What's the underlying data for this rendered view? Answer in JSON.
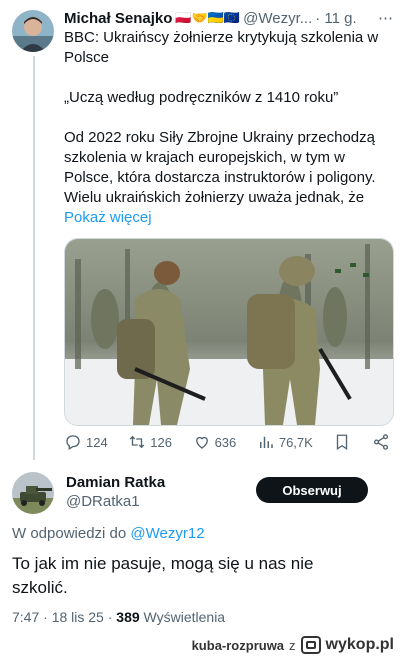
{
  "tweet1": {
    "author": "Michał Senajko",
    "flags": "🇵🇱🤝🇺🇦🇪🇺",
    "handle": "@Wezyr...",
    "time": "· 11 g.",
    "lines": [
      "BBC: Ukraińscy żołnierze krytykują szkolenia w",
      "Polsce",
      "",
      "„Uczą według podręczników z 1410 roku”",
      "",
      "Od 2022 roku Siły Zbrojne Ukrainy przechodzą",
      "szkolenia w krajach europejskich, w tym w",
      "Polsce, która dostarcza instruktorów i poligony.",
      "Wielu ukraińskich żołnierzy uważa jednak, że"
    ],
    "show_more": "Pokaż więcej",
    "stats": {
      "replies": "124",
      "reposts": "126",
      "likes": "636",
      "views": "76,7K"
    }
  },
  "tweet2": {
    "author": "Damian Ratka",
    "handle": "@DRatka1",
    "follow_label": "Obserwuj",
    "reply_to_prefix": "W odpowiedzi do",
    "reply_to_handle": "@Wezyr12",
    "text_line1": "To jak im nie pasuje, mogą się u nas nie",
    "text_line2": "szkolić.",
    "time": "7:47 · 18 lis 25 ·",
    "views_count": "389",
    "views_label": "Wyświetlenia"
  },
  "watermark": {
    "user": "kuba-rozpruwa",
    "sep": "z",
    "brand": "wykop.pl"
  },
  "icons": [
    "reply-icon",
    "repost-icon",
    "like-icon",
    "views-icon",
    "bookmark-icon",
    "share-icon",
    "wykop-logo-icon"
  ],
  "colors": {
    "link": "#1d9bf0",
    "muted": "#536471",
    "text": "#0f1419",
    "follow_bg": "#0f1419"
  }
}
